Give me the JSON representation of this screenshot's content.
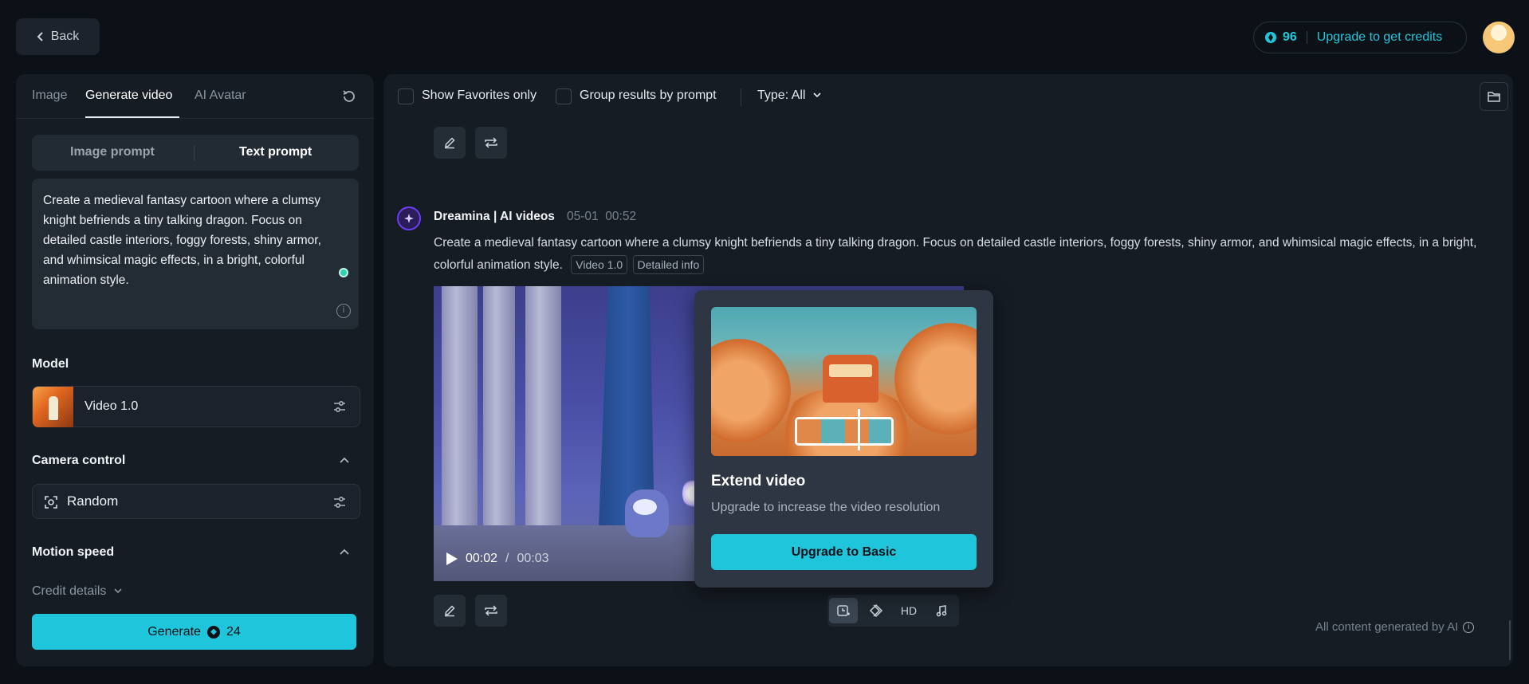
{
  "topbar": {
    "back_label": "Back",
    "credits": "96",
    "upgrade_label": "Upgrade to get credits"
  },
  "left_panel": {
    "tabs": [
      {
        "label": "Image",
        "active": false
      },
      {
        "label": "Generate video",
        "active": true
      },
      {
        "label": "AI Avatar",
        "active": false
      }
    ],
    "prompt_modes": [
      {
        "label": "Image prompt",
        "active": false
      },
      {
        "label": "Text prompt",
        "active": true
      }
    ],
    "prompt_text": "Create a medieval fantasy cartoon where a clumsy knight befriends a tiny talking dragon. Focus on detailed castle interiors, foggy forests, shiny armor, and whimsical magic effects, in a bright, colorful animation style.",
    "model_label": "Model",
    "model_value": "Video 1.0",
    "camera_label": "Camera control",
    "camera_value": "Random",
    "motion_label": "Motion speed",
    "credit_details_label": "Credit details",
    "generate_label": "Generate",
    "generate_cost": "24"
  },
  "filters": {
    "favorites_label": "Show Favorites only",
    "group_label": "Group results by prompt",
    "type_label": "Type: All"
  },
  "result": {
    "author": "Dreamina | AI videos",
    "date": "05-01",
    "time": "00:52",
    "prompt": "Create a medieval fantasy cartoon where a clumsy knight befriends a tiny talking dragon. Focus on detailed castle interiors, foggy forests, shiny armor, and whimsical magic effects, in a bright, colorful animation style.",
    "tags": [
      "Video 1.0",
      "Detailed info"
    ],
    "video": {
      "current_time": "00:02",
      "separator": "/",
      "total_time": "00:03"
    },
    "toolbar": {
      "hd_label": "HD"
    }
  },
  "popover": {
    "title": "Extend video",
    "subtitle": "Upgrade to increase the video resolution",
    "button_label": "Upgrade to Basic"
  },
  "footer": {
    "note": "All content generated by AI"
  },
  "colors": {
    "accent": "#1ec5db",
    "background": "#0c1117",
    "panel": "#161c24",
    "brand_purple": "#6c3ff0"
  }
}
